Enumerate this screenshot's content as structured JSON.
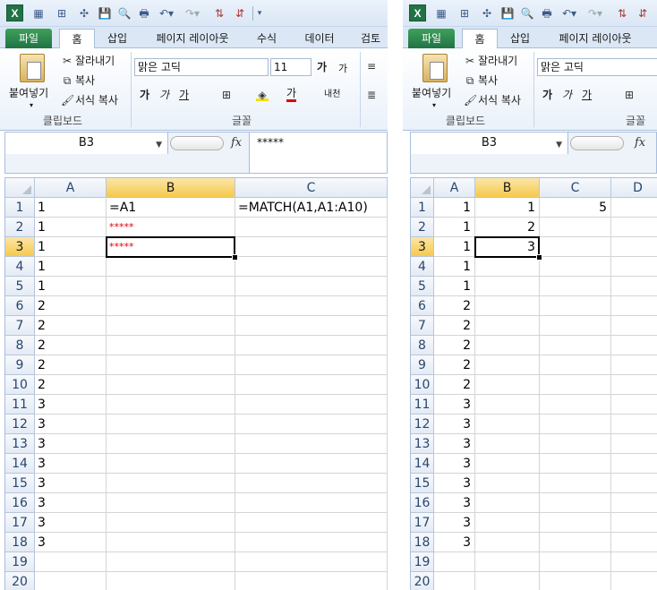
{
  "left": {
    "ribbon_tabs": [
      "파일",
      "홈",
      "삽입",
      "페이지 레이아웃",
      "수식",
      "데이터",
      "검토"
    ],
    "clipboard": {
      "paste": "붙여넣기",
      "cut": "잘라내기",
      "copy": "복사",
      "format_painter": "서식 복사",
      "group": "클립보드"
    },
    "font": {
      "name": "맑은 고딕",
      "size": "11",
      "group": "글꼴",
      "bold": "가",
      "italic": "가",
      "underline": "가",
      "font_color": "가",
      "grow": "가",
      "shrink": "가",
      "phonetic": "내천"
    },
    "name_box": "B3",
    "formula": "*****",
    "columns": [
      "A",
      "B",
      "C"
    ],
    "rows": [
      "1",
      "2",
      "3",
      "4",
      "5",
      "6",
      "7",
      "8",
      "9",
      "10",
      "11",
      "12",
      "13",
      "14",
      "15",
      "16",
      "17",
      "18",
      "19",
      "20"
    ],
    "col_a": [
      "1",
      "1",
      "1",
      "1",
      "1",
      "2",
      "2",
      "2",
      "2",
      "2",
      "3",
      "3",
      "3",
      "3",
      "3",
      "3",
      "3",
      "3",
      "",
      ""
    ],
    "col_b": [
      "=A1",
      "*****",
      "*****",
      "",
      "",
      "",
      "",
      "",
      "",
      "",
      "",
      "",
      "",
      "",
      "",
      "",
      "",
      "",
      "",
      ""
    ],
    "col_c": [
      "=MATCH(A1,A1:A10)",
      "",
      "",
      "",
      "",
      "",
      "",
      "",
      "",
      "",
      "",
      "",
      "",
      "",
      "",
      "",
      "",
      "",
      "",
      ""
    ]
  },
  "right": {
    "ribbon_tabs": [
      "파일",
      "홈",
      "삽입",
      "페이지 레이아웃"
    ],
    "clipboard": {
      "paste": "붙여넣기",
      "cut": "잘라내기",
      "copy": "복사",
      "format_painter": "서식 복사",
      "group": "클립보드"
    },
    "font": {
      "name": "맑은 고딕",
      "group": "글꼴",
      "bold": "가",
      "italic": "가",
      "underline": "가"
    },
    "name_box": "B3",
    "columns": [
      "A",
      "B",
      "C",
      "D"
    ],
    "rows": [
      "1",
      "2",
      "3",
      "4",
      "5",
      "6",
      "7",
      "8",
      "9",
      "10",
      "11",
      "12",
      "13",
      "14",
      "15",
      "16",
      "17",
      "18",
      "19",
      "20"
    ],
    "col_a": [
      "1",
      "1",
      "1",
      "1",
      "1",
      "2",
      "2",
      "2",
      "2",
      "2",
      "3",
      "3",
      "3",
      "3",
      "3",
      "3",
      "3",
      "3",
      "",
      ""
    ],
    "col_b": [
      "1",
      "2",
      "3",
      "",
      "",
      "",
      "",
      "",
      "",
      "",
      "",
      "",
      "",
      "",
      "",
      "",
      "",
      "",
      "",
      ""
    ],
    "col_c": [
      "5",
      "",
      "",
      "",
      "",
      "",
      "",
      "",
      "",
      "",
      "",
      "",
      "",
      "",
      "",
      "",
      "",
      "",
      "",
      ""
    ]
  },
  "colors": {
    "file_tab": "#217346",
    "selection_header": "#f6c94b",
    "error_stars": "#e00000",
    "ribbon_bg": "#dbe7f5"
  },
  "icons": [
    "excel-logo-icon",
    "save-icon",
    "undo-icon",
    "redo-icon",
    "sort-icon",
    "print-icon",
    "paste-icon",
    "cut-icon",
    "copy-icon",
    "format-painter-icon",
    "border-icon",
    "fill-color-icon",
    "fx-icon"
  ]
}
